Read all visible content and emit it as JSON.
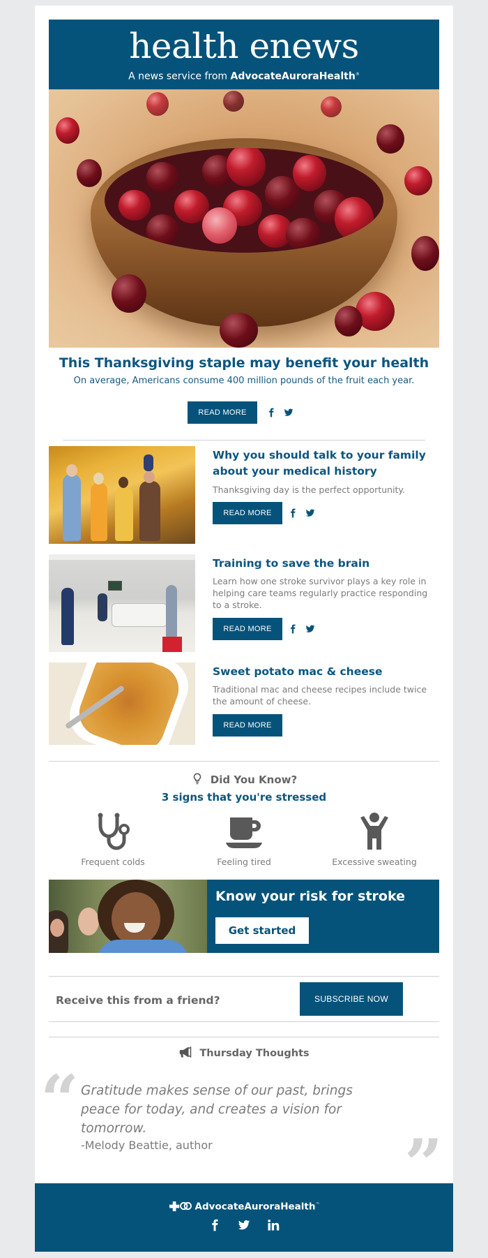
{
  "colors": {
    "brand_blue": "#05537a",
    "headline_blue": "#0b5680",
    "body_gray": "#7b7b7b",
    "page_bg": "#e9eaec"
  },
  "header": {
    "logo": "health enews",
    "tagline_prefix": "A news service from",
    "tagline_brand": "AdvocateAuroraHealth",
    "tagline_mark": "®"
  },
  "hero": {
    "image_alt": "Bowl of cranberries",
    "title": "This Thanksgiving staple may benefit your health",
    "subtitle": "On average, Americans consume 400 million pounds of the fruit each year.",
    "cta": "READ MORE",
    "share": [
      "facebook-icon",
      "twitter-icon"
    ]
  },
  "articles": [
    {
      "image_alt": "Multi-generational family walking in autumn",
      "title": "Why you should talk to your family about your medical history",
      "description": "Thanksgiving day is the perfect opportunity.",
      "cta": "READ MORE",
      "share": [
        "facebook-icon",
        "twitter-icon"
      ]
    },
    {
      "image_alt": "Care team in hospital room with patient",
      "title": "Training to save the brain",
      "description": "Learn how one stroke survivor plays a key role in helping care teams regularly practice responding to a stroke.",
      "cta": "READ MORE",
      "share": [
        "facebook-icon",
        "twitter-icon"
      ]
    },
    {
      "image_alt": "Sweet potato mac and cheese in a baking dish",
      "title": "Sweet potato mac & cheese",
      "description": "Traditional mac and cheese recipes include twice the amount of cheese.",
      "cta": "READ MORE",
      "share": []
    }
  ],
  "did_you_know": {
    "icon": "lightbulb-icon",
    "title": "Did You Know?",
    "subtitle": "3 signs that you're stressed",
    "signs": [
      {
        "icon": "stethoscope-icon",
        "label": "Frequent colds"
      },
      {
        "icon": "coffee-cup-icon",
        "label": "Feeling tired"
      },
      {
        "icon": "person-arms-up-icon",
        "label": "Excessive sweating"
      }
    ]
  },
  "stroke_banner": {
    "image_alt": "Smiling woman outdoors with friends",
    "title": "Know your risk for stroke",
    "cta": "Get started"
  },
  "subscribe": {
    "prompt": "Receive this from a friend?",
    "cta": "SUBSCRIBE NOW"
  },
  "thursday_thoughts": {
    "icon": "megaphone-icon",
    "title": "Thursday Thoughts",
    "quote": "Gratitude makes sense of our past, brings peace for today, and creates a vision for tomorrow.",
    "author": "-Melody Beattie, author",
    "open_mark": "“",
    "close_mark": "”"
  },
  "footer": {
    "brand": "AdvocateAuroraHealth",
    "brand_mark": "™",
    "social": [
      "facebook-icon",
      "twitter-icon",
      "linkedin-icon"
    ]
  }
}
